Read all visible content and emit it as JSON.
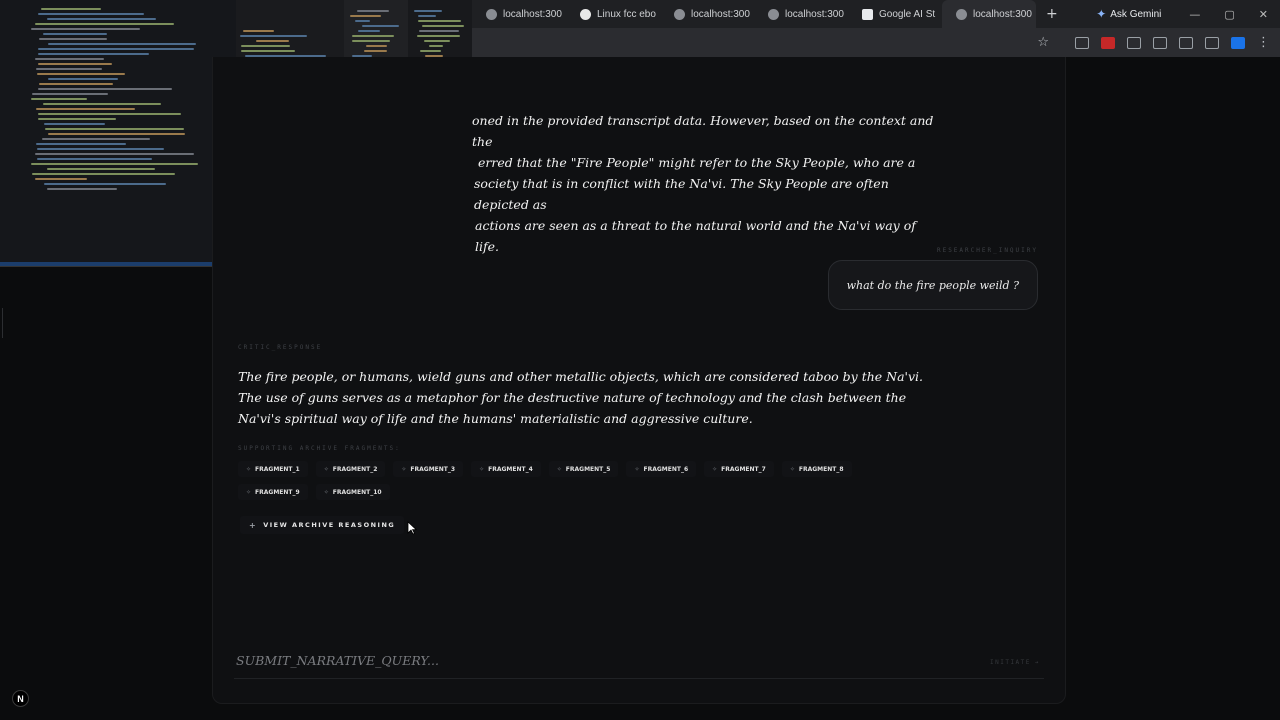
{
  "browser": {
    "tabs": [
      {
        "title": "localhost:300",
        "active": false
      },
      {
        "title": "Linux fcc ebo",
        "active": false
      },
      {
        "title": "localhost:300",
        "active": false
      },
      {
        "title": "localhost:300",
        "active": false
      },
      {
        "title": "Google AI St",
        "active": false
      },
      {
        "title": "localhost:300",
        "active": true
      }
    ],
    "new_tab": "+",
    "ask_gemini": "Ask Gemini"
  },
  "chat": {
    "previous_response_lines": [
      "oned in the provided transcript data. However, based on the context and the",
      "erred that the \"Fire People\" might refer to the Sky People, who are a",
      "society that is in conflict with the Na'vi. The Sky People are often depicted as",
      "actions are seen as a threat to the natural world and the Na'vi way of life."
    ],
    "inquiry_label": "RESEARCHER_INQUIRY",
    "user_message": "what do the fire people weild ?",
    "critic_label": "CRITIC_RESPONSE",
    "response": "The fire people, or humans, wield guns and other metallic objects, which are considered taboo by the Na'vi. The use of guns serves as a metaphor for the destructive nature of technology and the clash between the Na'vi's spiritual way of life and the humans' materialistic and aggressive culture.",
    "fragments_label": "SUPPORTING ARCHIVE FRAGMENTS:",
    "fragments": [
      "FRAGMENT_1",
      "FRAGMENT_2",
      "FRAGMENT_3",
      "FRAGMENT_4",
      "FRAGMENT_5",
      "FRAGMENT_6",
      "FRAGMENT_7",
      "FRAGMENT_8",
      "FRAGMENT_9",
      "FRAGMENT_10"
    ],
    "view_reasoning": "VIEW ARCHIVE REASONING"
  },
  "input": {
    "placeholder": "SUBMIT_NARRATIVE_QUERY...",
    "value": "",
    "submit_label": "INITIATE"
  },
  "badge": "N"
}
